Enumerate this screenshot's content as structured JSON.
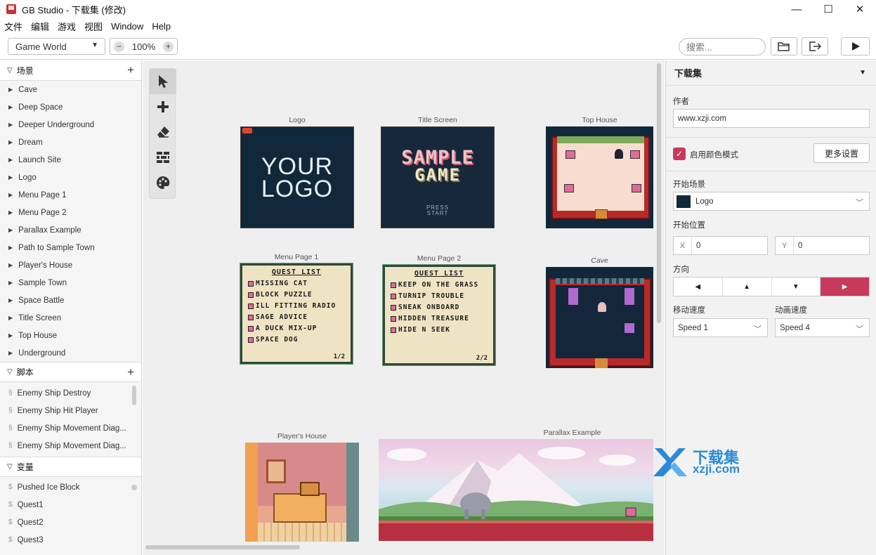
{
  "window": {
    "title": "GB Studio - 下载集 (修改)",
    "controls": [
      "—",
      "☐",
      "✕"
    ]
  },
  "menu": [
    "文件",
    "编辑",
    "游戏",
    "视图",
    "Window",
    "Help"
  ],
  "toolbar": {
    "world_select": "Game World",
    "zoom": "100%",
    "zoom_out": "−",
    "zoom_in": "+",
    "search_placeholder": "搜索..."
  },
  "sidebar": {
    "scenes": {
      "title": "场景",
      "items": [
        "Cave",
        "Deep Space",
        "Deeper Underground",
        "Dream",
        "Launch Site",
        "Logo",
        "Menu Page 1",
        "Menu Page 2",
        "Parallax Example",
        "Path to Sample Town",
        "Player's House",
        "Sample Town",
        "Space Battle",
        "Title Screen",
        "Top House",
        "Underground"
      ]
    },
    "scripts": {
      "title": "脚本",
      "items": [
        "Enemy Ship Destroy",
        "Enemy Ship Hit Player",
        "Enemy Ship Movement Diag...",
        "Enemy Ship Movement Diag..."
      ]
    },
    "variables": {
      "title": "变量",
      "items": [
        "Pushed Ice Block",
        "Quest1",
        "Quest2",
        "Quest3"
      ]
    }
  },
  "canvas": {
    "logo": {
      "label": "Logo",
      "text1": "YOUR",
      "text2": "LOGO"
    },
    "title_screen": {
      "label": "Title Screen",
      "line1": "SAMPLE",
      "line2": "GAME",
      "press": "PRESS",
      "start": "START"
    },
    "top_house": {
      "label": "Top House"
    },
    "menu1": {
      "label": "Menu Page 1",
      "heading": "QUEST LIST",
      "items": [
        "MISSING CAT",
        "BLOCK PUZZLE",
        "ILL FITTING RADIO",
        "SAGE ADVICE",
        "A DUCK MIX-UP",
        "SPACE DOG"
      ],
      "page": "1/2"
    },
    "menu2": {
      "label": "Menu Page 2",
      "heading": "QUEST LIST",
      "items": [
        "KEEP ON THE GRASS",
        "TURNIP TROUBLE",
        "SNEAK ONBOARD",
        "HIDDEN TREASURE",
        "HIDE N SEEK"
      ],
      "page": "2/2"
    },
    "cave": {
      "label": "Cave"
    },
    "players_house": {
      "label": "Player's House"
    },
    "parallax": {
      "label": "Parallax Example"
    }
  },
  "panel": {
    "title": "下载集",
    "author_label": "作者",
    "author_value": "www.xzji.com",
    "color_mode_label": "启用颜色模式",
    "more_settings": "更多设置",
    "start_scene_label": "开始场景",
    "start_scene_value": "Logo",
    "start_pos_label": "开始位置",
    "x_label": "X",
    "x_value": "0",
    "y_label": "Y",
    "y_value": "0",
    "direction_label": "方向",
    "directions": [
      "◀",
      "▲",
      "▼",
      "▶"
    ],
    "move_speed_label": "移动速度",
    "move_speed_value": "Speed 1",
    "anim_speed_label": "动画速度",
    "anim_speed_value": "Speed 4"
  },
  "watermark": {
    "cn": "下载集",
    "url": "xzji.com"
  },
  "colors": {
    "accent": "#c83a5c",
    "logo_bg": "#10283a",
    "canvas_bg": "#efefef"
  }
}
